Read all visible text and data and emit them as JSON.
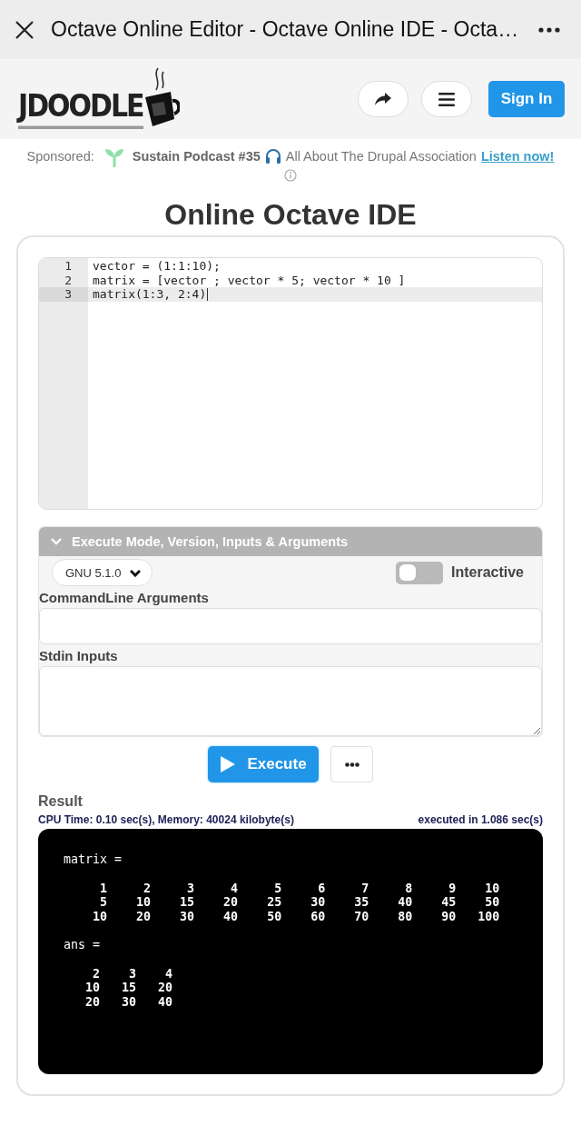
{
  "topbar": {
    "title": "Octave Online Editor - Octave Online IDE - Octa…"
  },
  "header": {
    "logo": "JDOODLE",
    "sign_in": "Sign In"
  },
  "sponsor": {
    "label": "Sponsored:",
    "title": "Sustain Podcast #35",
    "text": "All About The Drupal Association",
    "link": "Listen now!"
  },
  "heading": "Online Octave IDE",
  "editor": {
    "lines": [
      {
        "number": "1",
        "code": "vector = (1:1:10);",
        "active": false
      },
      {
        "number": "2",
        "code": "matrix = [vector ; vector * 5; vector * 10 ]",
        "active": false
      },
      {
        "number": "3",
        "code": "matrix(1:3, 2:4)",
        "active": true
      }
    ]
  },
  "options": {
    "title": "Execute Mode, Version, Inputs & Arguments",
    "expanded": true,
    "version": "GNU 5.1.0",
    "interactive": {
      "label": "Interactive",
      "on": false
    },
    "fields": [
      {
        "label": "CommandLine Arguments",
        "kind": "line"
      },
      {
        "label": "Stdin Inputs",
        "kind": "area"
      }
    ]
  },
  "execute_button": "Execute",
  "result": {
    "title": "Result",
    "stats": "CPU Time: 0.10 sec(s), Memory: 40024 kilobyte(s)",
    "elapsed": "executed in 1.086 sec(s)",
    "blocks": [
      {
        "heading": "matrix =",
        "rows": [
          "     1     2     3     4     5     6     7     8     9    10",
          "     5    10    15    20    25    30    35    40    45    50",
          "    10    20    30    40    50    60    70    80    90   100"
        ]
      },
      {
        "heading": "ans =",
        "rows": [
          "    2    3    4",
          "   10   15   20",
          "   20   30   40"
        ]
      }
    ]
  }
}
